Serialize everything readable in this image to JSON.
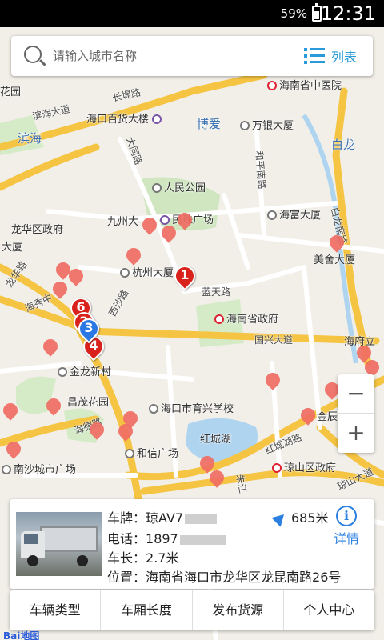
{
  "status_bar": {
    "battery": "59%",
    "time": "12:31"
  },
  "search": {
    "placeholder": "请输入城市名称",
    "list_label": "列表"
  },
  "map_labels": {
    "hainan_middle_hospital": "海南省中医院",
    "binhai_avenue": "滨海大道",
    "changti_road": "长堤路",
    "haikou_department_store": "海口百货大楼",
    "boai": "博爱",
    "wanyin_building": "万银大厦",
    "binhai": "滨海",
    "baillong": "白龙",
    "huapark": "花园",
    "datong_road": "大同路",
    "heping_south_road": "和平南路",
    "baillong_south_road": "白龙南路",
    "peoples_park": "人民公园",
    "jiuzhou": "九州大",
    "minzhu_square": "民珠广场",
    "haifu_building": "海富大厦",
    "longhua_gov": "龙华区政府",
    "daxia": "大厦",
    "hangzhou_building": "杭州大厦",
    "meiquan_building": "美舍大厦",
    "longhua_road": "龙华路",
    "xisha_road": "西沙路",
    "hainan_gov": "海南省政府",
    "lantian_road": "蓝天路",
    "guoxing_avenue": "国兴大道",
    "haifu_road": "海府立",
    "jinlong_village": "金龙新村",
    "changmao_garden": "昌茂花园",
    "haikou_sports_school": "海口市育兴学校",
    "haide_road": "海德路",
    "jinchen_plaza": "金辰",
    "honghu_lake": "红城湖",
    "hongcheng_road": "红城湖路",
    "hexin_square": "和信广场",
    "nansha_square": "南沙城市广场",
    "qiongshan_gov": "琼山区政府",
    "zhujiang": "朱江",
    "qiongshan_avenue": "琼山大道",
    "hainan_road_2": "海秀中"
  },
  "markers": {
    "numbered": [
      "1",
      "2",
      "3",
      "4",
      "6"
    ]
  },
  "zoom": {
    "minus": "−",
    "plus": "+"
  },
  "vehicle_card": {
    "plate_label": "车牌：",
    "plate_value": "琼AV7",
    "phone_label": "电话：",
    "phone_value": "1897",
    "length_label": "车长：",
    "length_value": "2.7米",
    "location_label": "位置：",
    "location_value": "海南省海口市龙华区龙昆南路26号",
    "distance": "685米",
    "info_icon": "i",
    "detail": "详情"
  },
  "bottom_nav": {
    "tabs": [
      "车辆类型",
      "车厢长度",
      "发布货源",
      "个人中心"
    ]
  },
  "logo": "Bai地图"
}
